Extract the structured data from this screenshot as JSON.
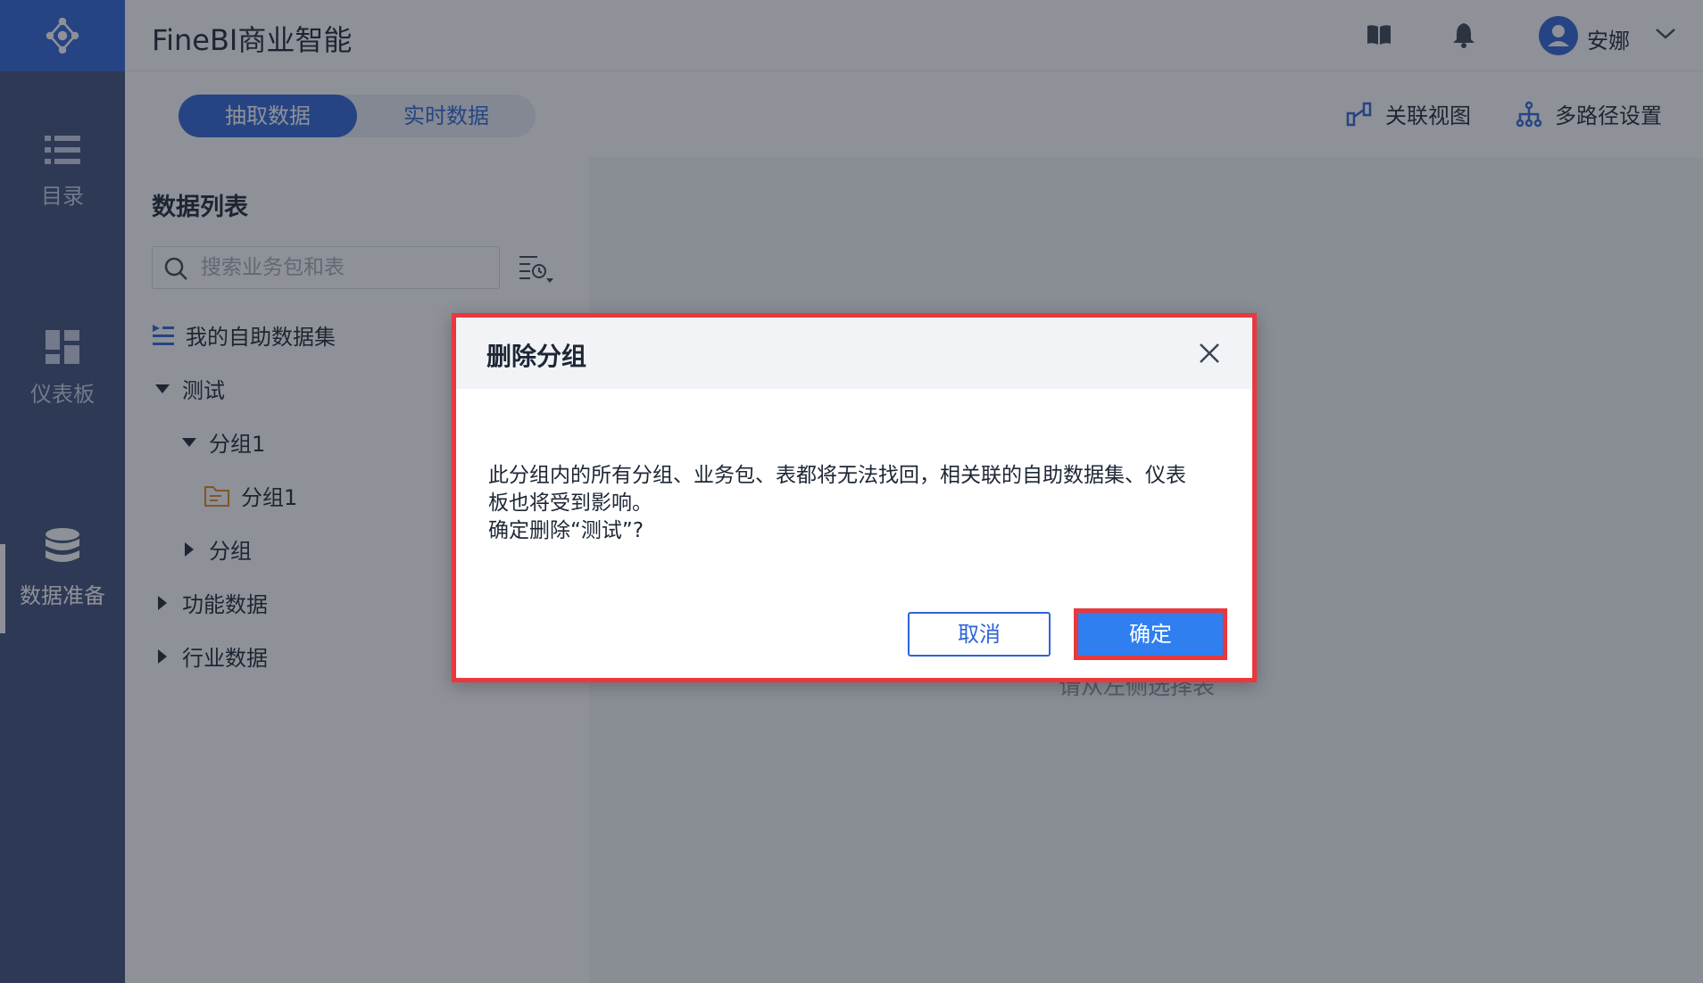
{
  "sidebar": {
    "items": [
      {
        "label": "目录",
        "icon": "list-icon"
      },
      {
        "label": "仪表板",
        "icon": "dashboard-icon"
      },
      {
        "label": "数据准备",
        "icon": "database-icon"
      }
    ],
    "active_index": 2
  },
  "header": {
    "title": "FineBI商业智能",
    "username": "安娜"
  },
  "tabs": [
    {
      "label": "抽取数据",
      "active": true
    },
    {
      "label": "实时数据",
      "active": false
    }
  ],
  "toolbar": {
    "relation_view": "关联视图",
    "multipath": "多路径设置"
  },
  "data_list": {
    "title": "数据列表",
    "search_placeholder": "搜索业务包和表",
    "tree": [
      {
        "label": "我的自助数据集"
      },
      {
        "label": "测试",
        "expanded": true
      },
      {
        "label": "分组1",
        "expanded": true
      },
      {
        "label": "分组1"
      },
      {
        "label": "分组",
        "expanded": false
      },
      {
        "label": "功能数据",
        "expanded": false
      },
      {
        "label": "行业数据",
        "expanded": false
      }
    ]
  },
  "empty_hint": "请从左侧选择表",
  "dialog": {
    "title": "删除分组",
    "message_line1": "此分组内的所有分组、业务包、表都将无法找回，相关联的自助数据集、仪表",
    "message_line2": "板也将受到影响。",
    "message_line3": "确定删除“测试”?",
    "cancel_label": "取消",
    "ok_label": "确定"
  },
  "colors": {
    "primary": "#2f64d6",
    "sidebar": "#3c4f7a",
    "highlight_border": "#e8383d"
  }
}
